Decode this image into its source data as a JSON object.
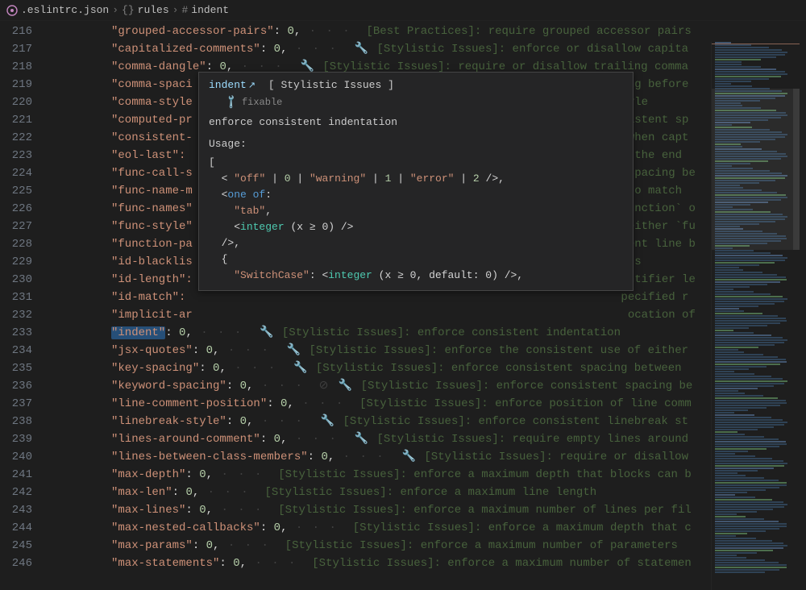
{
  "breadcrumb": {
    "file": ".eslintrc.json",
    "path1_icon": "{}",
    "path1": "rules",
    "path2_icon": "#",
    "path2": "indent"
  },
  "lines": [
    {
      "n": 216,
      "key": "grouped-accessor-pairs",
      "val": "0",
      "hint": "[Best Practices]: require grouped accessor pairs",
      "wrench": false
    },
    {
      "n": 217,
      "key": "capitalized-comments",
      "val": "0",
      "hint": "[Stylistic Issues]: enforce or disallow capita",
      "wrench": true
    },
    {
      "n": 218,
      "key": "comma-dangle",
      "val": "0",
      "hint": "[Stylistic Issues]: require or disallow trailing comma",
      "wrench": true
    },
    {
      "n": 219,
      "key": "comma-spaci",
      "val": "",
      "hint": "ng before",
      "truncated": true
    },
    {
      "n": 220,
      "key": "comma-style",
      "val": "",
      "hint": "yle",
      "truncated": true
    },
    {
      "n": 221,
      "key": "computed-pr",
      "val": "",
      "hint": "istent sp",
      "truncated": true
    },
    {
      "n": 222,
      "key": "consistent-",
      "val": "",
      "hint": "when capt",
      "truncated": true
    },
    {
      "n": 223,
      "key": "eol-last\":",
      "val": "",
      "hint": "t the end",
      "truncated": true
    },
    {
      "n": 224,
      "key": "func-call-s",
      "val": "",
      "hint": "spacing be",
      "truncated": true
    },
    {
      "n": 225,
      "key": "func-name-m",
      "val": "",
      "hint": "to match",
      "truncated": true
    },
    {
      "n": 226,
      "key": "func-names\"",
      "val": "",
      "hint": "unction` o",
      "truncated": true
    },
    {
      "n": 227,
      "key": "func-style\"",
      "val": "",
      "hint": "either `fu",
      "truncated": true
    },
    {
      "n": 228,
      "key": "function-pa",
      "val": "",
      "hint": "ent line b",
      "truncated": true
    },
    {
      "n": 229,
      "key": "id-blacklis",
      "val": "",
      "hint": "rs",
      "truncated": true
    },
    {
      "n": 230,
      "key": "id-length\":",
      "val": "",
      "hint": "ntifier le",
      "truncated": true
    },
    {
      "n": 231,
      "key": "id-match\":",
      "val": "",
      "hint": "pecified r",
      "truncated": true
    },
    {
      "n": 232,
      "key": "implicit-ar",
      "val": "",
      "hint": "ocation of",
      "truncated": true
    },
    {
      "n": 233,
      "key": "indent",
      "val": "0",
      "hint": "[Stylistic Issues]: enforce consistent indentation",
      "wrench": true,
      "highlight": true
    },
    {
      "n": 234,
      "key": "jsx-quotes",
      "val": "0",
      "hint": "[Stylistic Issues]: enforce the consistent use of either",
      "wrench": true
    },
    {
      "n": 235,
      "key": "key-spacing",
      "val": "0",
      "hint": "[Stylistic Issues]: enforce consistent spacing between",
      "wrench": true
    },
    {
      "n": 236,
      "key": "keyword-spacing",
      "val": "0",
      "hint": "[Stylistic Issues]: enforce consistent spacing be",
      "wrench": true,
      "special": true
    },
    {
      "n": 237,
      "key": "line-comment-position",
      "val": "0",
      "hint": "[Stylistic Issues]: enforce position of line comm",
      "wrench": false
    },
    {
      "n": 238,
      "key": "linebreak-style",
      "val": "0",
      "hint": "[Stylistic Issues]: enforce consistent linebreak st",
      "wrench": true
    },
    {
      "n": 239,
      "key": "lines-around-comment",
      "val": "0",
      "hint": "[Stylistic Issues]: require empty lines around",
      "wrench": true
    },
    {
      "n": 240,
      "key": "lines-between-class-members",
      "val": "0",
      "hint": "[Stylistic Issues]: require or disallow",
      "wrench": true
    },
    {
      "n": 241,
      "key": "max-depth",
      "val": "0",
      "hint": "[Stylistic Issues]: enforce a maximum depth that blocks can b",
      "wrench": false
    },
    {
      "n": 242,
      "key": "max-len",
      "val": "0",
      "hint": "[Stylistic Issues]: enforce a maximum line length",
      "wrench": false
    },
    {
      "n": 243,
      "key": "max-lines",
      "val": "0",
      "hint": "[Stylistic Issues]: enforce a maximum number of lines per fil",
      "wrench": false
    },
    {
      "n": 244,
      "key": "max-nested-callbacks",
      "val": "0",
      "hint": "[Stylistic Issues]: enforce a maximum depth that c",
      "wrench": false
    },
    {
      "n": 245,
      "key": "max-params",
      "val": "0",
      "hint": "[Stylistic Issues]: enforce a maximum number of parameters",
      "wrench": false
    },
    {
      "n": 246,
      "key": "max-statements",
      "val": "0",
      "hint": "[Stylistic Issues]: enforce a maximum number of statemen",
      "wrench": false
    }
  ],
  "hover": {
    "rule": "indent",
    "ext_icon": "↗",
    "category": "[ Stylistic Issues ]",
    "fixable_label": "fixable",
    "description": "enforce consistent indentation",
    "usage_label": "Usage:",
    "off": "\"off\"",
    "warning": "\"warning\"",
    "error": "\"error\"",
    "one_of": "one of",
    "tab": "\"tab\"",
    "integer": "integer",
    "integer_constraint": "(x ≥ 0)",
    "switchcase": "\"SwitchCase\"",
    "switchcase_constraint": "(x ≥ 0, default: 0)"
  }
}
